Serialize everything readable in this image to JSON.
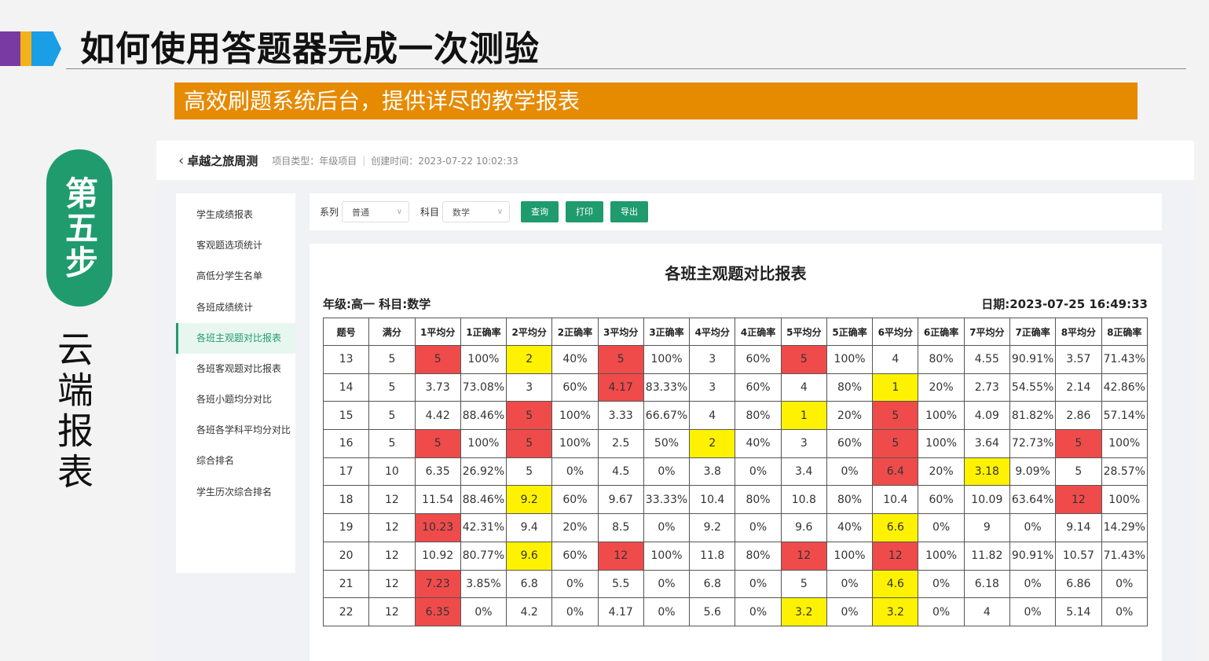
{
  "slide": {
    "title": "如何使用答题器完成一次测验",
    "banner": "高效刷题系统后台，提供详尽的教学报表",
    "step": "第五步",
    "side_label": "云端报表"
  },
  "app": {
    "project_name": "卓越之旅周测",
    "project_type": "项目类型：年级项目",
    "created_time": "创建时间：2023-07-22 10:02:33",
    "nav": [
      {
        "label": "学生成绩报表",
        "active": false
      },
      {
        "label": "客观题选项统计",
        "active": false
      },
      {
        "label": "高低分学生名单",
        "active": false
      },
      {
        "label": "各班成绩统计",
        "active": false
      },
      {
        "label": "各班主观题对比报表",
        "active": true
      },
      {
        "label": "各班客观题对比报表",
        "active": false
      },
      {
        "label": "各班小题均分对比",
        "active": false
      },
      {
        "label": "各班各学科平均分对比",
        "active": false
      },
      {
        "label": "综合排名",
        "active": false
      },
      {
        "label": "学生历次综合排名",
        "active": false
      }
    ],
    "filters": {
      "series_label": "系列",
      "series_value": "普通",
      "subject_label": "科目",
      "subject_value": "数学",
      "query_button": "查询",
      "print_button": "打印",
      "export_button": "导出"
    },
    "report": {
      "title": "各班主观题对比报表",
      "meta_left": "年级:高一 科目:数学",
      "meta_right": "日期:2023-07-25 16:49:33",
      "headers": [
        "题号",
        "满分",
        "1平均分",
        "1正确率",
        "2平均分",
        "2正确率",
        "3平均分",
        "3正确率",
        "4平均分",
        "4正确率",
        "5平均分",
        "5正确率",
        "6平均分",
        "6正确率",
        "7平均分",
        "7正确率",
        "8平均分",
        "8正确率"
      ],
      "rows": [
        [
          "13",
          "5",
          "5",
          "100%",
          "2",
          "40%",
          "5",
          "100%",
          "3",
          "60%",
          "5",
          "100%",
          "4",
          "80%",
          "4.55",
          "90.91%",
          "3.57",
          "71.43%"
        ],
        [
          "14",
          "5",
          "3.73",
          "73.08%",
          "3",
          "60%",
          "4.17",
          "83.33%",
          "3",
          "60%",
          "4",
          "80%",
          "1",
          "20%",
          "2.73",
          "54.55%",
          "2.14",
          "42.86%"
        ],
        [
          "15",
          "5",
          "4.42",
          "88.46%",
          "5",
          "100%",
          "3.33",
          "66.67%",
          "4",
          "80%",
          "1",
          "20%",
          "5",
          "100%",
          "4.09",
          "81.82%",
          "2.86",
          "57.14%"
        ],
        [
          "16",
          "5",
          "5",
          "100%",
          "5",
          "100%",
          "2.5",
          "50%",
          "2",
          "40%",
          "3",
          "60%",
          "5",
          "100%",
          "3.64",
          "72.73%",
          "5",
          "100%"
        ],
        [
          "17",
          "10",
          "6.35",
          "26.92%",
          "5",
          "0%",
          "4.5",
          "0%",
          "3.8",
          "0%",
          "3.4",
          "0%",
          "6.4",
          "20%",
          "3.18",
          "9.09%",
          "5",
          "28.57%"
        ],
        [
          "18",
          "12",
          "11.54",
          "88.46%",
          "9.2",
          "60%",
          "9.67",
          "33.33%",
          "10.4",
          "80%",
          "10.8",
          "80%",
          "10.4",
          "60%",
          "10.09",
          "63.64%",
          "12",
          "100%"
        ],
        [
          "19",
          "12",
          "10.23",
          "42.31%",
          "9.4",
          "20%",
          "8.5",
          "0%",
          "9.2",
          "0%",
          "9.6",
          "40%",
          "6.6",
          "0%",
          "9",
          "0%",
          "9.14",
          "14.29%"
        ],
        [
          "20",
          "12",
          "10.92",
          "80.77%",
          "9.6",
          "60%",
          "12",
          "100%",
          "11.8",
          "80%",
          "12",
          "100%",
          "12",
          "100%",
          "11.82",
          "90.91%",
          "10.57",
          "71.43%"
        ],
        [
          "21",
          "12",
          "7.23",
          "3.85%",
          "6.8",
          "0%",
          "5.5",
          "0%",
          "6.8",
          "0%",
          "5",
          "0%",
          "4.6",
          "0%",
          "6.18",
          "0%",
          "6.86",
          "0%"
        ],
        [
          "22",
          "12",
          "6.35",
          "0%",
          "4.2",
          "0%",
          "4.17",
          "0%",
          "5.6",
          "0%",
          "3.2",
          "0%",
          "3.2",
          "0%",
          "4",
          "0%",
          "5.14",
          "0%"
        ]
      ],
      "highlights": {
        "red": [
          [
            0,
            2
          ],
          [
            0,
            6
          ],
          [
            0,
            10
          ],
          [
            1,
            6
          ],
          [
            2,
            4
          ],
          [
            2,
            12
          ],
          [
            3,
            2
          ],
          [
            3,
            4
          ],
          [
            3,
            12
          ],
          [
            3,
            16
          ],
          [
            4,
            12
          ],
          [
            5,
            16
          ],
          [
            6,
            2
          ],
          [
            7,
            6
          ],
          [
            7,
            10
          ],
          [
            7,
            12
          ],
          [
            8,
            2
          ],
          [
            9,
            2
          ]
        ],
        "yellow": [
          [
            0,
            4
          ],
          [
            1,
            12
          ],
          [
            2,
            10
          ],
          [
            3,
            8
          ],
          [
            4,
            14
          ],
          [
            5,
            4
          ],
          [
            6,
            12
          ],
          [
            7,
            4
          ],
          [
            8,
            12
          ],
          [
            9,
            10
          ],
          [
            9,
            12
          ]
        ]
      },
      "highlight_colors": {
        "red": "#f04b4b",
        "yellow": "#fff200"
      }
    }
  }
}
